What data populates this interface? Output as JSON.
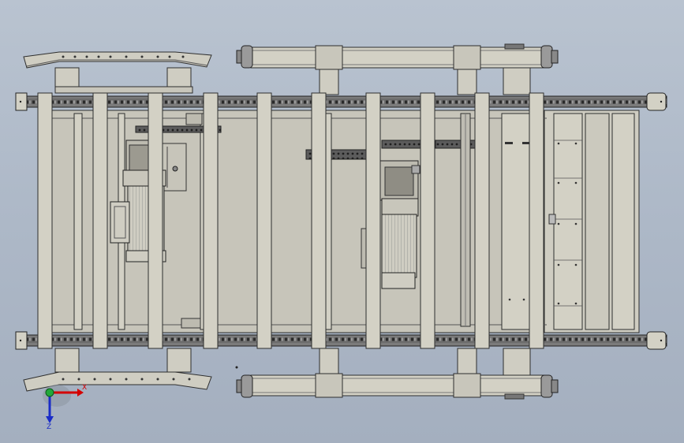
{
  "view": {
    "background_top": "#b9c3d0",
    "background_bottom": "#a4afbf",
    "frame_fill": "#d3d1c5",
    "frame_stroke": "#2e2e2e",
    "chain_color": "#4a4a4a",
    "motor_fill": "#cfcdc2"
  },
  "axis_triad": {
    "x_label": "X",
    "z_label": "Z",
    "x_color": "#d40000",
    "z_color": "#1a2cc8",
    "origin_color": "#22a83a"
  },
  "icons": {
    "triad": "axis-triad-icon",
    "wheel": "wheel-icon",
    "motor": "motor-icon"
  }
}
